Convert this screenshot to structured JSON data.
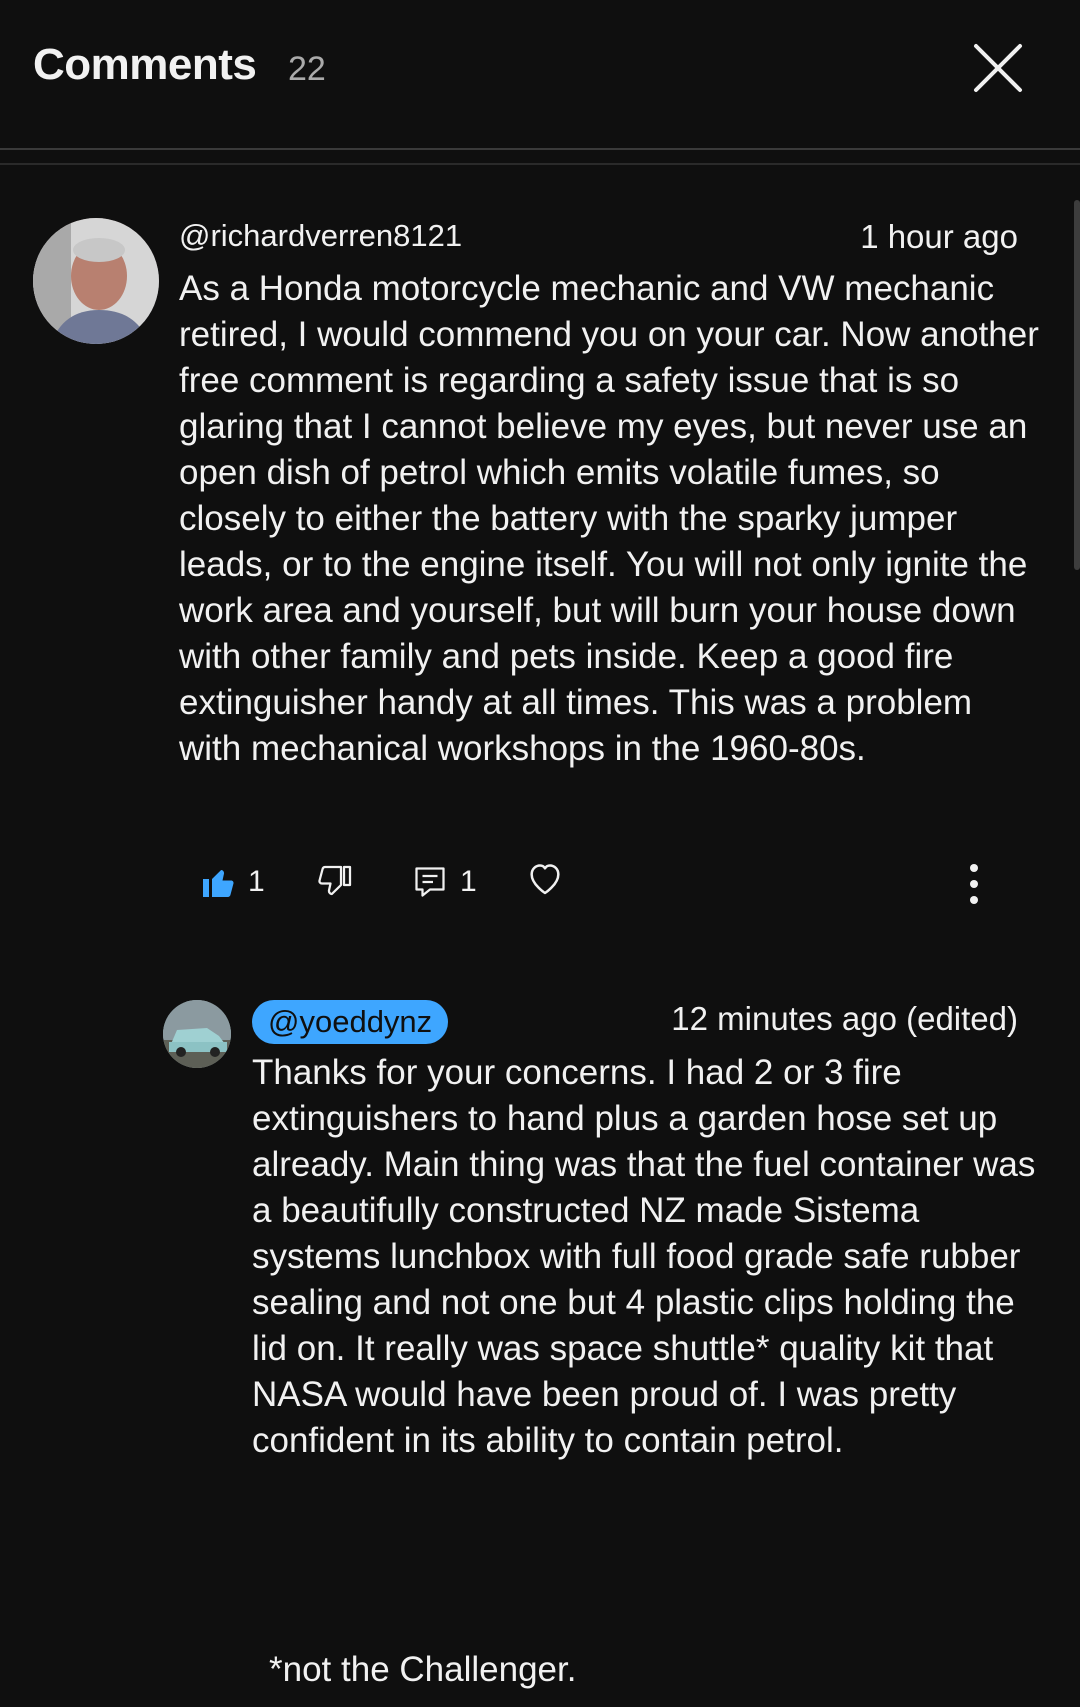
{
  "header": {
    "title": "Comments",
    "count": "22"
  },
  "comments": [
    {
      "username": "@richardverren8121",
      "time": "1 hour ago",
      "text": "As a Honda motorcycle mechanic and VW mechanic retired, I would commend you on your car. Now another free comment is regarding a safety issue that is so glaring that I cannot believe my eyes, but never use an open dish of petrol which emits volatile fumes, so closely to either the battery with the sparky jumper leads, or to the engine itself. You will not only ignite the work area and yourself, but will burn your house down with other family and pets inside. Keep a good fire extinguisher handy at all times. This was a problem with mechanical workshops in the 1960-80s.",
      "likes": "1",
      "replies": "1"
    }
  ],
  "reply": {
    "username": "@yoeddynz",
    "time": "12 minutes ago (edited)",
    "text": "Thanks for your concerns. I had 2 or 3 fire extinguishers to hand plus a garden hose set up already. Main thing was that the fuel container was a beautifully constructed NZ made Sistema systems lunchbox with full food grade safe rubber sealing and not one but 4 plastic clips holding the lid on. It really was space shuttle* quality kit that NASA would have been proud of.  I was pretty confident in its ability to contain petrol.",
    "footnote": "*not the Challenger."
  },
  "colors": {
    "background": "#0f0f0f",
    "accent": "#3ea6ff",
    "text": "#f1f1f1",
    "muted": "#aaaaaa"
  },
  "icons": {
    "close": "close-icon",
    "like": "thumbs-up-icon",
    "dislike": "thumbs-down-icon",
    "reply": "reply-icon",
    "heart": "heart-icon",
    "more": "more-vertical-icon"
  }
}
